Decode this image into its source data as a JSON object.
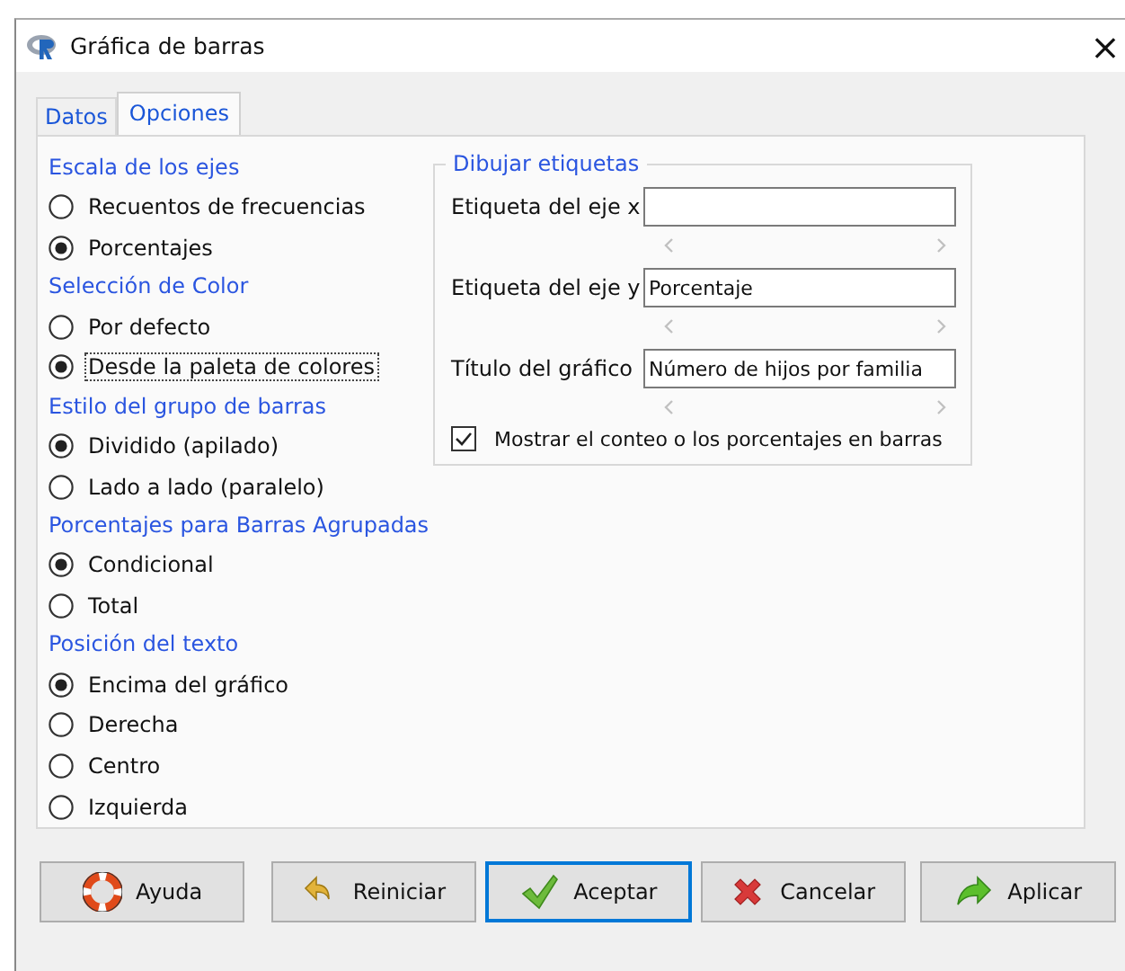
{
  "window": {
    "title": "Gráfica de barras",
    "close": "×"
  },
  "tabs": [
    {
      "label": "Datos",
      "selected": false
    },
    {
      "label": "Opciones",
      "selected": true
    }
  ],
  "groups": [
    {
      "title": "Escala de los ejes",
      "options": [
        {
          "label": "Recuentos de frecuencias",
          "selected": false,
          "focused": false
        },
        {
          "label": "Porcentajes",
          "selected": true,
          "focused": false
        }
      ]
    },
    {
      "title": "Selección de Color",
      "options": [
        {
          "label": "Por defecto",
          "selected": false,
          "focused": false
        },
        {
          "label": "Desde la paleta de colores",
          "selected": true,
          "focused": true
        }
      ]
    },
    {
      "title": "Estilo del grupo de barras",
      "options": [
        {
          "label": "Dividido (apilado)",
          "selected": true,
          "focused": false
        },
        {
          "label": "Lado a lado (paralelo)",
          "selected": false,
          "focused": false
        }
      ]
    },
    {
      "title": "Porcentajes para Barras Agrupadas",
      "options": [
        {
          "label": "Condicional",
          "selected": true,
          "focused": false
        },
        {
          "label": "Total",
          "selected": false,
          "focused": false
        }
      ]
    },
    {
      "title": "Posición del texto",
      "options": [
        {
          "label": "Encima del gráfico",
          "selected": true,
          "focused": false
        },
        {
          "label": "Derecha",
          "selected": false,
          "focused": false
        },
        {
          "label": "Centro",
          "selected": false,
          "focused": false
        },
        {
          "label": "Izquierda",
          "selected": false,
          "focused": false
        }
      ]
    }
  ],
  "labels_frame": {
    "title": "Dibujar etiquetas",
    "fields": [
      {
        "label": "Etiqueta del eje x"
      },
      {
        "label": "Etiqueta del eje y",
        "value": "Porcentaje"
      },
      {
        "label": "Título del gráfico",
        "value": "Número de hijos por familia"
      }
    ],
    "checkbox": {
      "label": "Mostrar el conteo o los porcentajes en barras",
      "checked": true
    }
  },
  "buttons": [
    {
      "label": "Ayuda",
      "kind": "help",
      "focused": false
    },
    {
      "label": "Reiniciar",
      "kind": "reset",
      "focused": false
    },
    {
      "label": "Aceptar",
      "kind": "ok",
      "focused": true
    },
    {
      "label": "Cancelar",
      "kind": "cancel",
      "focused": false
    },
    {
      "label": "Aplicar",
      "kind": "apply",
      "focused": false
    }
  ]
}
